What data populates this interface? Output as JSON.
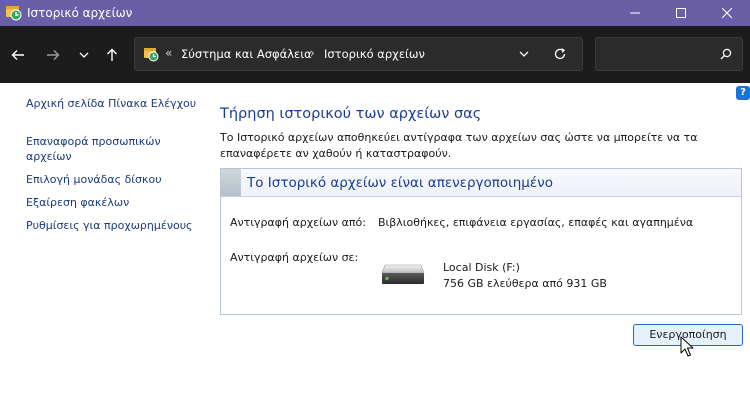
{
  "window": {
    "title": "Ιστορικό αρχείων",
    "controls": {
      "minimize": "minimize-icon",
      "maximize": "maximize-icon",
      "close": "close-icon"
    }
  },
  "nav": {
    "breadcrumb_lead": "«",
    "breadcrumb": [
      "Σύστημα και Ασφάλεια",
      "Ιστορικό αρχείων"
    ],
    "separator": "›",
    "search": {
      "value": "",
      "placeholder": ""
    }
  },
  "sidebar": {
    "items": [
      {
        "label": "Αρχική σελίδα Πίνακα Ελέγχου"
      },
      {
        "label": "Επαναφορά προσωπικών αρχείων"
      },
      {
        "label": "Επιλογή μονάδας δίσκου"
      },
      {
        "label": "Εξαίρεση φακέλων"
      },
      {
        "label": "Ρυθμίσεις για προχωρημένους"
      }
    ]
  },
  "main": {
    "title": "Τήρηση ιστορικού των αρχείων σας",
    "description": "Το Ιστορικό αρχείων αποθηκεύει αντίγραφα των αρχείων σας ώστε να μπορείτε να τα επαναφέρετε αν χαθούν ή καταστραφούν.",
    "panel": {
      "status": "Το Ιστορικό αρχείων είναι απενεργοποιημένο",
      "copy_from_label": "Αντιγραφή αρχείων από:",
      "copy_from_value": "Βιβλιοθήκες, επιφάνεια εργασίας, επαφές και αγαπημένα",
      "copy_to_label": "Αντιγραφή αρχείων σε:",
      "drive_name": "Local Disk (F:)",
      "drive_space": "756 GB ελεύθερα από 931 GB"
    },
    "enable_button": "Ενεργοποίηση"
  },
  "help": "?",
  "colors": {
    "titlebar": "#6a5fa7",
    "navbar": "#1c1c1c",
    "link": "#1a3a78",
    "heading": "#1a3d8f",
    "accent_button_border": "#2a64c5"
  }
}
